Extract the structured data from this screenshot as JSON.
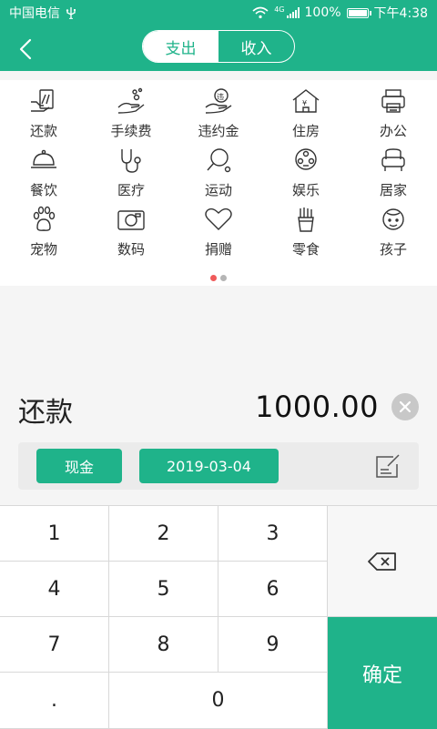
{
  "status_bar": {
    "carrier": "中国电信",
    "usb_icon": "usb-icon",
    "network": "4G",
    "battery": "100%",
    "time": "下午4:38"
  },
  "header": {
    "tabs": [
      {
        "label": "支出",
        "active": true
      },
      {
        "label": "收入",
        "active": false
      }
    ]
  },
  "categories": [
    {
      "label": "还款",
      "icon": "repayment-icon"
    },
    {
      "label": "手续费",
      "icon": "fee-icon"
    },
    {
      "label": "违约金",
      "icon": "penalty-icon"
    },
    {
      "label": "住房",
      "icon": "housing-icon"
    },
    {
      "label": "办公",
      "icon": "office-icon"
    },
    {
      "label": "餐饮",
      "icon": "dining-icon"
    },
    {
      "label": "医疗",
      "icon": "medical-icon"
    },
    {
      "label": "运动",
      "icon": "sports-icon"
    },
    {
      "label": "娱乐",
      "icon": "entertainment-icon"
    },
    {
      "label": "居家",
      "icon": "home-icon"
    },
    {
      "label": "宠物",
      "icon": "pet-icon"
    },
    {
      "label": "数码",
      "icon": "camera-icon"
    },
    {
      "label": "捐赠",
      "icon": "donation-icon"
    },
    {
      "label": "零食",
      "icon": "snack-icon"
    },
    {
      "label": "孩子",
      "icon": "child-icon"
    }
  ],
  "page_indicator": {
    "current": 1,
    "total": 2
  },
  "entry": {
    "category": "还款",
    "amount": "1000.00"
  },
  "options": {
    "account": "现金",
    "date": "2019-03-04"
  },
  "keypad": {
    "keys": [
      "1",
      "2",
      "3",
      "4",
      "5",
      "6",
      "7",
      "8",
      "9",
      ".",
      "0"
    ],
    "confirm_label": "确定"
  },
  "colors": {
    "accent": "#1fb38a",
    "indicator_active": "#f05a5a",
    "indicator_inactive": "#b5b5b5"
  }
}
